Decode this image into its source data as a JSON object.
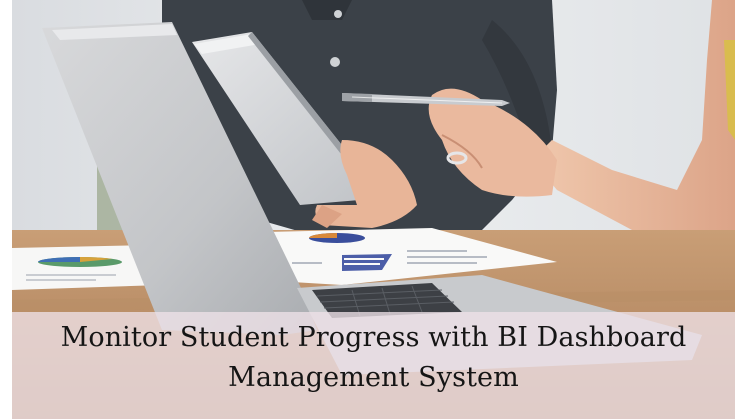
{
  "banner": {
    "caption_line1": "Monitor Student Progress with BI Dashboard",
    "caption_line2": "Management System"
  },
  "colors": {
    "caption_band": "#eee2e8",
    "caption_text": "#151515",
    "desk": "#b58a64",
    "wall": "#e3e5e8",
    "shirt": "#3b4148",
    "skin": "#e6b69a"
  },
  "icons": [
    "laptop-icon",
    "tablet-icon",
    "pen-icon",
    "pie-chart-icon"
  ]
}
